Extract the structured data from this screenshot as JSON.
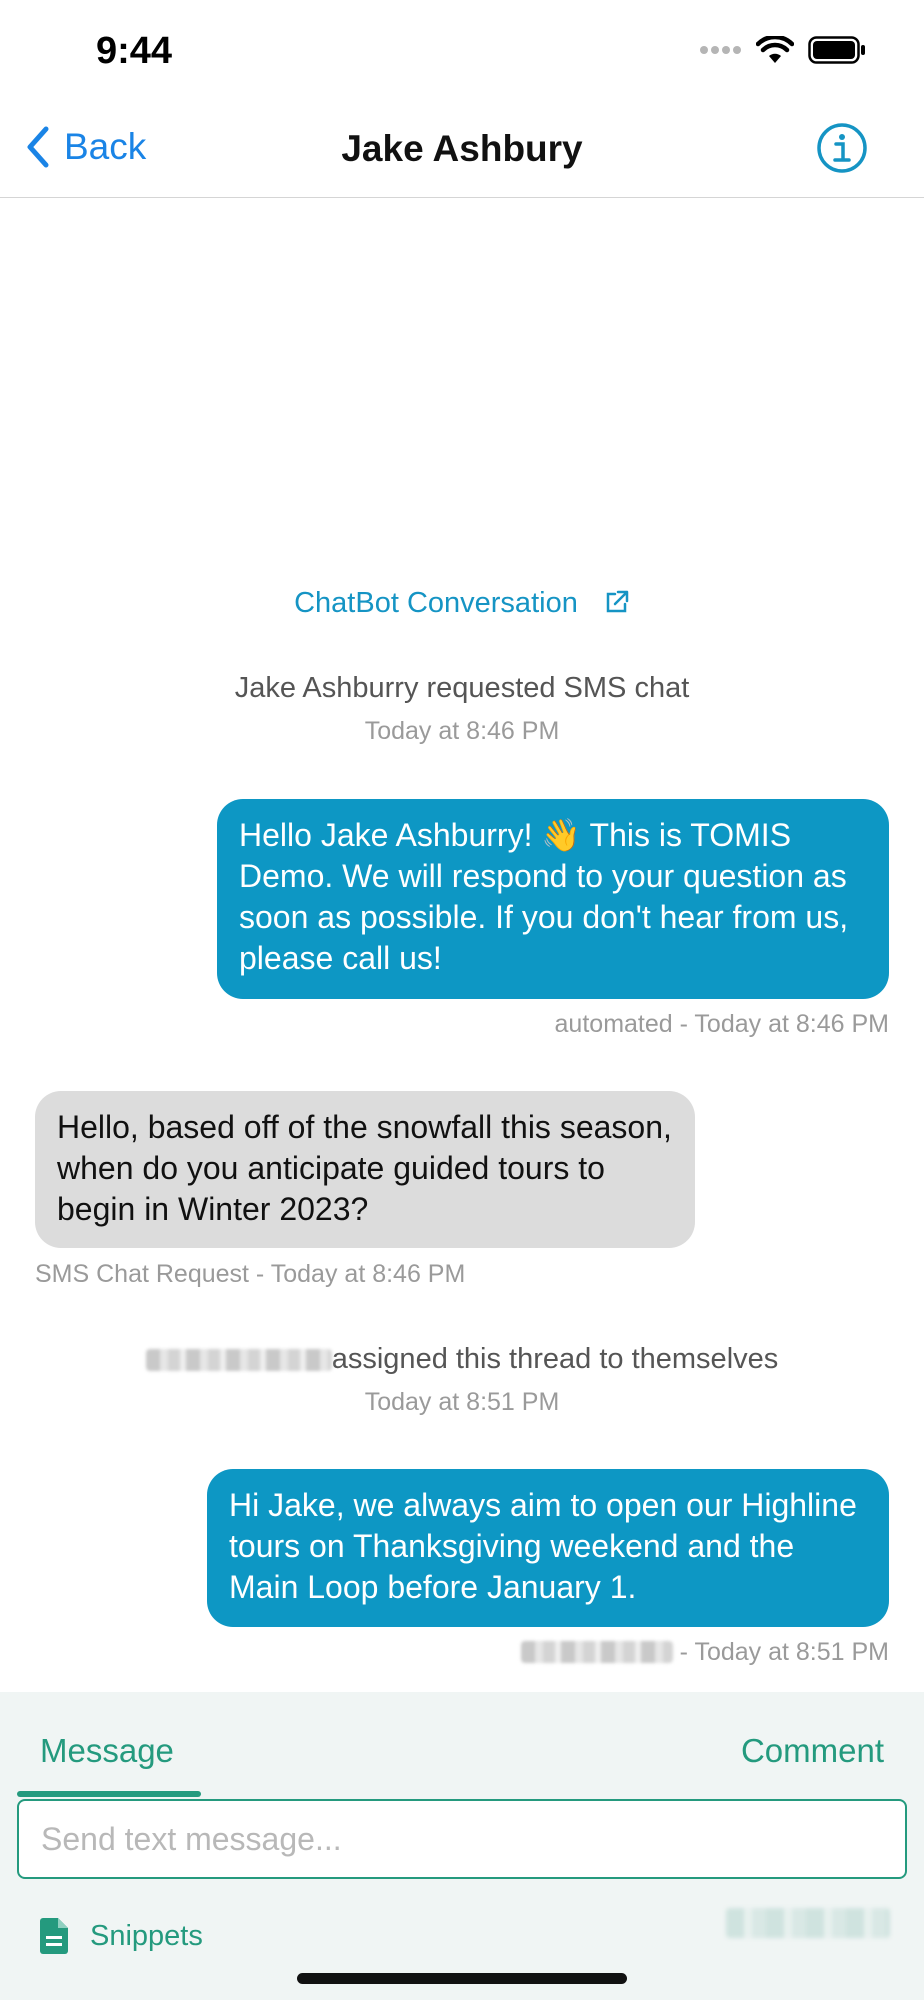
{
  "status_bar": {
    "time": "9:44"
  },
  "nav": {
    "back_label": "Back",
    "title": "Jake Ashbury"
  },
  "chatbot_link": "ChatBot Conversation",
  "events": [
    {
      "text": "Jake Ashburry requested SMS chat",
      "time": "Today at 8:46 PM"
    },
    {
      "text": "assigned this thread to themselves",
      "time": "Today at 8:51 PM"
    }
  ],
  "messages": [
    {
      "direction": "outgoing",
      "text": "Hello Jake Ashburry! 👋 This is TOMIS Demo. We will respond to your question as soon as possible. If you don't hear from us, please call us!",
      "meta": "automated - Today at 8:46 PM"
    },
    {
      "direction": "incoming",
      "text": "Hello, based off of the snowfall this season, when do you anticipate guided tours to begin in Winter 2023?",
      "meta": "SMS Chat Request - Today at 8:46 PM"
    },
    {
      "direction": "outgoing",
      "text": "Hi Jake, we always aim to open our Highline tours on Thanksgiving weekend and the Main Loop before January 1.",
      "meta": "- Today at 8:51 PM"
    }
  ],
  "composer": {
    "tabs": [
      "Message",
      "Comment"
    ],
    "active_tab": "Message",
    "placeholder": "Send text message...",
    "snippets_label": "Snippets"
  },
  "colors": {
    "accent_blue": "#1a84e6",
    "bubble_out": "#0d97c4",
    "bubble_in": "#dcdcdc",
    "accent_green": "#249a7e"
  }
}
